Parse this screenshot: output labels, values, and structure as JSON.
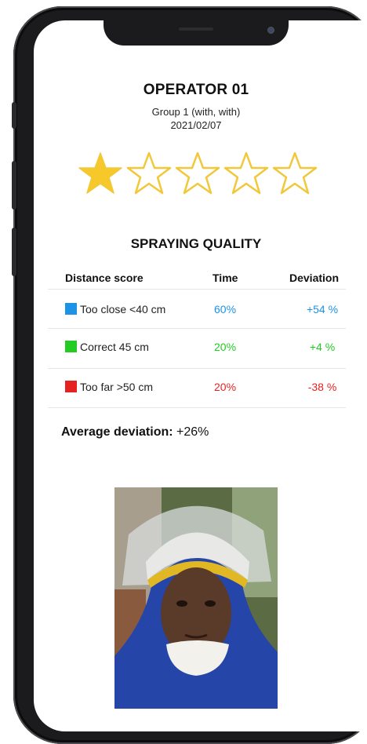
{
  "operator": {
    "name": "OPERATOR 01",
    "group": "Group 1 (with, with)",
    "date": "2021/02/07"
  },
  "rating": {
    "value": 1,
    "max": 5,
    "filled_color": "#f7c82a",
    "outline_color": "#f2c83a"
  },
  "section_title": "SPRAYING QUALITY",
  "table": {
    "headers": {
      "distance": "Distance score",
      "time": "Time",
      "deviation": "Deviation"
    },
    "rows": [
      {
        "label": "Too close <40 cm",
        "time": "60%",
        "deviation": "+54 %",
        "color": "#1c93e5"
      },
      {
        "label": "Correct 45 cm",
        "time": "20%",
        "deviation": "+4 %",
        "color": "#22cc22"
      },
      {
        "label": "Too far >50 cm",
        "time": "20%",
        "deviation": "-38 %",
        "color": "#e42222"
      }
    ]
  },
  "average": {
    "label": "Average deviation:",
    "value": "+26%"
  }
}
